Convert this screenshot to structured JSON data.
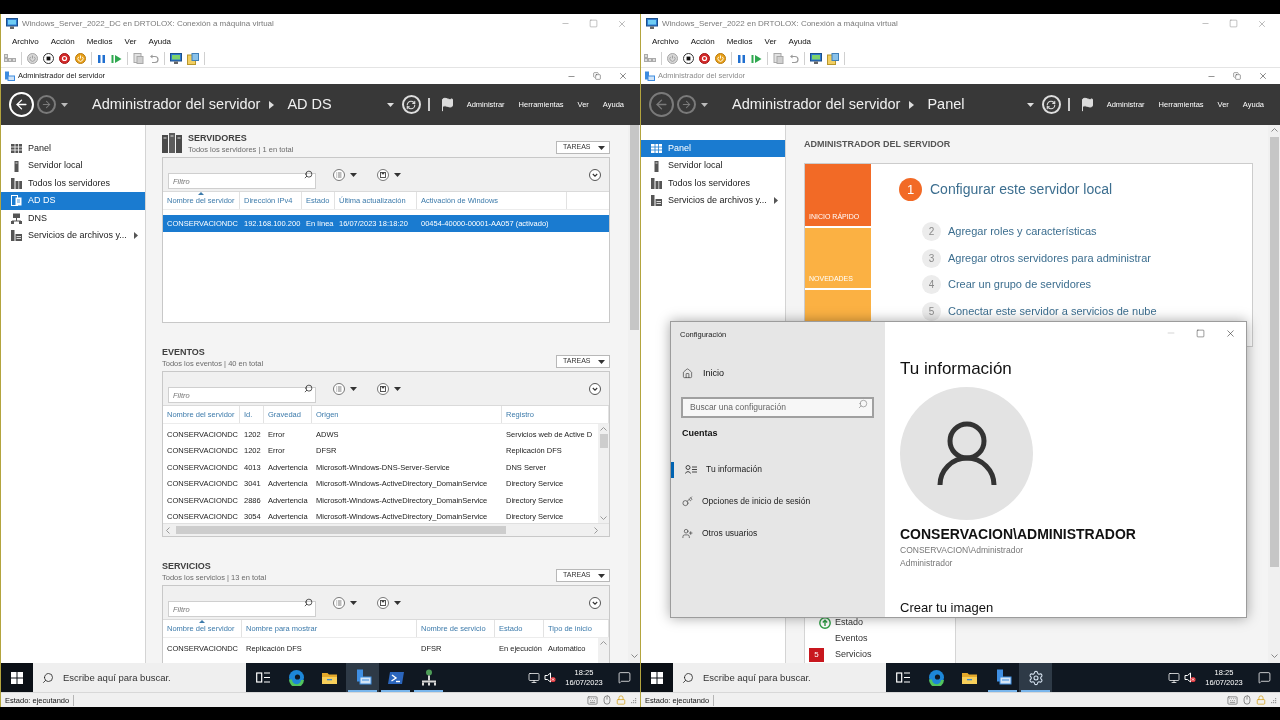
{
  "vm_windows": [
    {
      "title": "Windows_Server_2022_DC en DRTOLOX: Conexión a máquina virtual",
      "menu": [
        "Archivo",
        "Acción",
        "Medios",
        "Ver",
        "Ayuda"
      ],
      "app_window": {
        "title": "Administrador del servidor",
        "active": true
      },
      "nav_buttons": [
        {
          "kind": "back",
          "disabled": false
        },
        {
          "kind": "forward",
          "disabled": true
        }
      ],
      "breadcrumb": [
        "Administrador del servidor",
        "AD DS"
      ],
      "header_menu": [
        "Administrar",
        "Herramientas",
        "Ver",
        "Ayuda"
      ],
      "sidebar": [
        {
          "kind": "dashboard",
          "label": "Panel",
          "selected": false,
          "expandable": false
        },
        {
          "kind": "local_server",
          "label": "Servidor local",
          "selected": false,
          "expandable": false
        },
        {
          "kind": "all_servers",
          "label": "Todos los servidores",
          "selected": false,
          "expandable": false
        },
        {
          "kind": "ad_ds",
          "label": "AD DS",
          "selected": true,
          "expandable": false
        },
        {
          "kind": "dns",
          "label": "DNS",
          "selected": false,
          "expandable": false
        },
        {
          "kind": "file_services",
          "label": "Servicios de archivos y...",
          "selected": false,
          "expandable": true
        }
      ],
      "content": {
        "kind": "role",
        "sections": [
          {
            "kind": "servers",
            "title": "SERVIDORES",
            "subtitle": "Todos los servidores | 1 en total",
            "tasks_button": "TAREAS",
            "filter_placeholder": "Filtro",
            "columns": [
              {
                "label": "Nombre del servidor",
                "sorted": true
              },
              {
                "label": "Dirección IPv4",
                "sorted": false
              },
              {
                "label": "Estado",
                "sorted": false
              },
              {
                "label": "Última actualización",
                "sorted": false
              },
              {
                "label": "Activación de Windows",
                "sorted": false
              }
            ],
            "rows": [
              {
                "selected": true,
                "cells": [
                  "CONSERVACIONDC",
                  "192.168.100.200",
                  "En línea",
                  "16/07/2023 18:18:20",
                  "00454-40000-00001-AA057 (activado)"
                ]
              }
            ]
          },
          {
            "kind": "events",
            "title": "EVENTOS",
            "subtitle": "Todos los eventos | 40 en total",
            "tasks_button": "TAREAS",
            "filter_placeholder": "Filtro",
            "columns": [
              {
                "label": "Nombre del servidor",
                "sorted": false
              },
              {
                "label": "Id.",
                "sorted": false
              },
              {
                "label": "Gravedad",
                "sorted": false
              },
              {
                "label": "Origen",
                "sorted": false
              },
              {
                "label": "Registro",
                "sorted": false
              }
            ],
            "rows": [
              {
                "selected": false,
                "cells": [
                  "CONSERVACIONDC",
                  "1202",
                  "Error",
                  "ADWS",
                  "Servicios web de Active D"
                ]
              },
              {
                "selected": false,
                "cells": [
                  "CONSERVACIONDC",
                  "1202",
                  "Error",
                  "DFSR",
                  "Replicación DFS"
                ]
              },
              {
                "selected": false,
                "cells": [
                  "CONSERVACIONDC",
                  "4013",
                  "Advertencia",
                  "Microsoft-Windows-DNS-Server-Service",
                  "DNS Server"
                ]
              },
              {
                "selected": false,
                "cells": [
                  "CONSERVACIONDC",
                  "3041",
                  "Advertencia",
                  "Microsoft-Windows-ActiveDirectory_DomainService",
                  "Directory Service"
                ]
              },
              {
                "selected": false,
                "cells": [
                  "CONSERVACIONDC",
                  "2886",
                  "Advertencia",
                  "Microsoft-Windows-ActiveDirectory_DomainService",
                  "Directory Service"
                ]
              },
              {
                "selected": false,
                "cells": [
                  "CONSERVACIONDC",
                  "3054",
                  "Advertencia",
                  "Microsoft-Windows-ActiveDirectory_DomainService",
                  "Directory Service"
                ]
              }
            ]
          },
          {
            "kind": "services",
            "title": "SERVICIOS",
            "subtitle": "Todos los servicios | 13 en total",
            "tasks_button": "TAREAS",
            "filter_placeholder": "Filtro",
            "columns": [
              {
                "label": "Nombre del servidor",
                "sorted": true
              },
              {
                "label": "Nombre para mostrar",
                "sorted": false
              },
              {
                "label": "Nombre de servicio",
                "sorted": false
              },
              {
                "label": "Estado",
                "sorted": false
              },
              {
                "label": "Tipo de inicio",
                "sorted": false
              }
            ],
            "rows": [
              {
                "selected": false,
                "cells": [
                  "CONSERVACIONDC",
                  "Replicación DFS",
                  "DFSR",
                  "En ejecución",
                  "Automático"
                ]
              }
            ]
          }
        ]
      },
      "taskbar": {
        "search_placeholder": "Escribe aquí para buscar.",
        "apps": [
          {
            "kind": "task_view",
            "active": false,
            "running": false
          },
          {
            "kind": "edge",
            "active": false,
            "running": false
          },
          {
            "kind": "file_explorer",
            "active": false,
            "running": false
          },
          {
            "kind": "server_manager",
            "active": true,
            "running": true
          },
          {
            "kind": "powershell",
            "active": false,
            "running": true
          },
          {
            "kind": "network_tool",
            "active": false,
            "running": true
          }
        ],
        "time": "18:25",
        "date": "16/07/2023"
      },
      "status_bar": "Estado: ejecutando"
    },
    {
      "title": "Windows_Server_2022 en DRTOLOX: Conexión a máquina virtual",
      "menu": [
        "Archivo",
        "Acción",
        "Medios",
        "Ver",
        "Ayuda"
      ],
      "app_window": {
        "title": "Administrador del servidor",
        "active": false
      },
      "nav_buttons": [
        {
          "kind": "back",
          "disabled": true
        },
        {
          "kind": "forward",
          "disabled": true
        }
      ],
      "breadcrumb": [
        "Administrador del servidor",
        "Panel"
      ],
      "header_menu": [
        "Administrar",
        "Herramientas",
        "Ver",
        "Ayuda"
      ],
      "sidebar": [
        {
          "kind": "dashboard",
          "label": "Panel",
          "selected": true,
          "expandable": false
        },
        {
          "kind": "local_server",
          "label": "Servidor local",
          "selected": false,
          "expandable": false
        },
        {
          "kind": "all_servers",
          "label": "Todos los servidores",
          "selected": false,
          "expandable": false
        },
        {
          "kind": "file_services",
          "label": "Servicios de archivos y...",
          "selected": false,
          "expandable": true
        }
      ],
      "content": {
        "kind": "dashboard",
        "heading": "ADMINISTRADOR DEL SERVIDOR",
        "tiles": [
          {
            "label": "INICIO RÁPIDO",
            "color": "#f26a26"
          },
          {
            "label": "NOVEDADES",
            "color": "#fbb143"
          },
          {
            "color": "#fbb143"
          }
        ],
        "steps": [
          {
            "number": "1",
            "label": "Configurar este servidor local",
            "selected": true
          },
          {
            "number": "2",
            "label": "Agregar roles y características",
            "selected": false
          },
          {
            "number": "3",
            "label": "Agregar otros servidores para administrar",
            "selected": false
          },
          {
            "number": "4",
            "label": "Crear un grupo de servidores",
            "selected": false
          },
          {
            "number": "5",
            "label": "Conectar este servidor a servicios de nube",
            "selected": false
          }
        ],
        "role_items": [
          {
            "kind": "status",
            "label": "Estado"
          },
          {
            "kind": "plain",
            "label": "Eventos"
          },
          {
            "kind": "count",
            "badge": "5",
            "label": "Servicios"
          }
        ]
      },
      "dialog": {
        "title": "Configuración",
        "home": "Inicio",
        "search_placeholder": "Buscar una configuración",
        "group": "Cuentas",
        "nav": [
          {
            "kind": "your_info",
            "label": "Tu información",
            "selected": true
          },
          {
            "kind": "sign_in_options",
            "label": "Opciones de inicio de sesión",
            "selected": false
          },
          {
            "kind": "other_users",
            "label": "Otros usuarios",
            "selected": false
          }
        ],
        "heading": "Tu información",
        "account_name": "CONSERVACION\\ADMINISTRADOR",
        "account_id": "CONSERVACION\\Administrador",
        "account_type": "Administrador",
        "link": "Crear tu imagen"
      },
      "taskbar": {
        "search_placeholder": "Escribe aquí para buscar.",
        "apps": [
          {
            "kind": "task_view",
            "active": false,
            "running": false
          },
          {
            "kind": "edge",
            "active": false,
            "running": false
          },
          {
            "kind": "file_explorer",
            "active": false,
            "running": false
          },
          {
            "kind": "server_manager",
            "active": false,
            "running": true
          },
          {
            "kind": "settings",
            "active": true,
            "running": true
          }
        ],
        "time": "18:25",
        "date": "16/07/2023"
      },
      "status_bar": "Estado: ejecutando"
    }
  ]
}
